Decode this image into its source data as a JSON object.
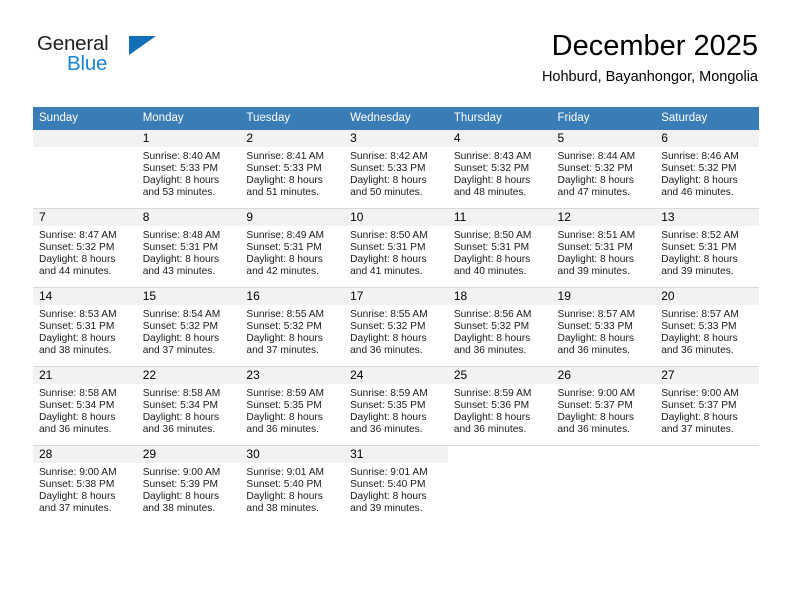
{
  "logo": {
    "word_top": "General",
    "word_bottom": "Blue",
    "triangle_color": "#136fb7",
    "blue_color": "#1c85d6"
  },
  "header": {
    "title": "December 2025",
    "subtitle": "Hohburd, Bayanhongor, Mongolia"
  },
  "theme": {
    "header_bg": "#3a7cb5",
    "daynum_bg": "#f2f2f2",
    "grid_line": "#d9d9d9"
  },
  "weekday_headers": [
    "Sunday",
    "Monday",
    "Tuesday",
    "Wednesday",
    "Thursday",
    "Friday",
    "Saturday"
  ],
  "weeks": [
    [
      {
        "day": "",
        "blank": true,
        "sunrise": "",
        "sunset": "",
        "daylight_line1": "",
        "daylight_line2": ""
      },
      {
        "day": "1",
        "sunrise": "Sunrise: 8:40 AM",
        "sunset": "Sunset: 5:33 PM",
        "daylight_line1": "Daylight: 8 hours",
        "daylight_line2": "and 53 minutes."
      },
      {
        "day": "2",
        "sunrise": "Sunrise: 8:41 AM",
        "sunset": "Sunset: 5:33 PM",
        "daylight_line1": "Daylight: 8 hours",
        "daylight_line2": "and 51 minutes."
      },
      {
        "day": "3",
        "sunrise": "Sunrise: 8:42 AM",
        "sunset": "Sunset: 5:33 PM",
        "daylight_line1": "Daylight: 8 hours",
        "daylight_line2": "and 50 minutes."
      },
      {
        "day": "4",
        "sunrise": "Sunrise: 8:43 AM",
        "sunset": "Sunset: 5:32 PM",
        "daylight_line1": "Daylight: 8 hours",
        "daylight_line2": "and 48 minutes."
      },
      {
        "day": "5",
        "sunrise": "Sunrise: 8:44 AM",
        "sunset": "Sunset: 5:32 PM",
        "daylight_line1": "Daylight: 8 hours",
        "daylight_line2": "and 47 minutes."
      },
      {
        "day": "6",
        "sunrise": "Sunrise: 8:46 AM",
        "sunset": "Sunset: 5:32 PM",
        "daylight_line1": "Daylight: 8 hours",
        "daylight_line2": "and 46 minutes."
      }
    ],
    [
      {
        "day": "7",
        "sunrise": "Sunrise: 8:47 AM",
        "sunset": "Sunset: 5:32 PM",
        "daylight_line1": "Daylight: 8 hours",
        "daylight_line2": "and 44 minutes."
      },
      {
        "day": "8",
        "sunrise": "Sunrise: 8:48 AM",
        "sunset": "Sunset: 5:31 PM",
        "daylight_line1": "Daylight: 8 hours",
        "daylight_line2": "and 43 minutes."
      },
      {
        "day": "9",
        "sunrise": "Sunrise: 8:49 AM",
        "sunset": "Sunset: 5:31 PM",
        "daylight_line1": "Daylight: 8 hours",
        "daylight_line2": "and 42 minutes."
      },
      {
        "day": "10",
        "sunrise": "Sunrise: 8:50 AM",
        "sunset": "Sunset: 5:31 PM",
        "daylight_line1": "Daylight: 8 hours",
        "daylight_line2": "and 41 minutes."
      },
      {
        "day": "11",
        "sunrise": "Sunrise: 8:50 AM",
        "sunset": "Sunset: 5:31 PM",
        "daylight_line1": "Daylight: 8 hours",
        "daylight_line2": "and 40 minutes."
      },
      {
        "day": "12",
        "sunrise": "Sunrise: 8:51 AM",
        "sunset": "Sunset: 5:31 PM",
        "daylight_line1": "Daylight: 8 hours",
        "daylight_line2": "and 39 minutes."
      },
      {
        "day": "13",
        "sunrise": "Sunrise: 8:52 AM",
        "sunset": "Sunset: 5:31 PM",
        "daylight_line1": "Daylight: 8 hours",
        "daylight_line2": "and 39 minutes."
      }
    ],
    [
      {
        "day": "14",
        "sunrise": "Sunrise: 8:53 AM",
        "sunset": "Sunset: 5:31 PM",
        "daylight_line1": "Daylight: 8 hours",
        "daylight_line2": "and 38 minutes."
      },
      {
        "day": "15",
        "sunrise": "Sunrise: 8:54 AM",
        "sunset": "Sunset: 5:32 PM",
        "daylight_line1": "Daylight: 8 hours",
        "daylight_line2": "and 37 minutes."
      },
      {
        "day": "16",
        "sunrise": "Sunrise: 8:55 AM",
        "sunset": "Sunset: 5:32 PM",
        "daylight_line1": "Daylight: 8 hours",
        "daylight_line2": "and 37 minutes."
      },
      {
        "day": "17",
        "sunrise": "Sunrise: 8:55 AM",
        "sunset": "Sunset: 5:32 PM",
        "daylight_line1": "Daylight: 8 hours",
        "daylight_line2": "and 36 minutes."
      },
      {
        "day": "18",
        "sunrise": "Sunrise: 8:56 AM",
        "sunset": "Sunset: 5:32 PM",
        "daylight_line1": "Daylight: 8 hours",
        "daylight_line2": "and 36 minutes."
      },
      {
        "day": "19",
        "sunrise": "Sunrise: 8:57 AM",
        "sunset": "Sunset: 5:33 PM",
        "daylight_line1": "Daylight: 8 hours",
        "daylight_line2": "and 36 minutes."
      },
      {
        "day": "20",
        "sunrise": "Sunrise: 8:57 AM",
        "sunset": "Sunset: 5:33 PM",
        "daylight_line1": "Daylight: 8 hours",
        "daylight_line2": "and 36 minutes."
      }
    ],
    [
      {
        "day": "21",
        "sunrise": "Sunrise: 8:58 AM",
        "sunset": "Sunset: 5:34 PM",
        "daylight_line1": "Daylight: 8 hours",
        "daylight_line2": "and 36 minutes."
      },
      {
        "day": "22",
        "sunrise": "Sunrise: 8:58 AM",
        "sunset": "Sunset: 5:34 PM",
        "daylight_line1": "Daylight: 8 hours",
        "daylight_line2": "and 36 minutes."
      },
      {
        "day": "23",
        "sunrise": "Sunrise: 8:59 AM",
        "sunset": "Sunset: 5:35 PM",
        "daylight_line1": "Daylight: 8 hours",
        "daylight_line2": "and 36 minutes."
      },
      {
        "day": "24",
        "sunrise": "Sunrise: 8:59 AM",
        "sunset": "Sunset: 5:35 PM",
        "daylight_line1": "Daylight: 8 hours",
        "daylight_line2": "and 36 minutes."
      },
      {
        "day": "25",
        "sunrise": "Sunrise: 8:59 AM",
        "sunset": "Sunset: 5:36 PM",
        "daylight_line1": "Daylight: 8 hours",
        "daylight_line2": "and 36 minutes."
      },
      {
        "day": "26",
        "sunrise": "Sunrise: 9:00 AM",
        "sunset": "Sunset: 5:37 PM",
        "daylight_line1": "Daylight: 8 hours",
        "daylight_line2": "and 36 minutes."
      },
      {
        "day": "27",
        "sunrise": "Sunrise: 9:00 AM",
        "sunset": "Sunset: 5:37 PM",
        "daylight_line1": "Daylight: 8 hours",
        "daylight_line2": "and 37 minutes."
      }
    ],
    [
      {
        "day": "28",
        "sunrise": "Sunrise: 9:00 AM",
        "sunset": "Sunset: 5:38 PM",
        "daylight_line1": "Daylight: 8 hours",
        "daylight_line2": "and 37 minutes."
      },
      {
        "day": "29",
        "sunrise": "Sunrise: 9:00 AM",
        "sunset": "Sunset: 5:39 PM",
        "daylight_line1": "Daylight: 8 hours",
        "daylight_line2": "and 38 minutes."
      },
      {
        "day": "30",
        "sunrise": "Sunrise: 9:01 AM",
        "sunset": "Sunset: 5:40 PM",
        "daylight_line1": "Daylight: 8 hours",
        "daylight_line2": "and 38 minutes."
      },
      {
        "day": "31",
        "sunrise": "Sunrise: 9:01 AM",
        "sunset": "Sunset: 5:40 PM",
        "daylight_line1": "Daylight: 8 hours",
        "daylight_line2": "and 39 minutes."
      },
      {
        "day": "",
        "nocell": true,
        "sunrise": "",
        "sunset": "",
        "daylight_line1": "",
        "daylight_line2": ""
      },
      {
        "day": "",
        "nocell": true,
        "sunrise": "",
        "sunset": "",
        "daylight_line1": "",
        "daylight_line2": ""
      },
      {
        "day": "",
        "nocell": true,
        "sunrise": "",
        "sunset": "",
        "daylight_line1": "",
        "daylight_line2": ""
      }
    ]
  ]
}
